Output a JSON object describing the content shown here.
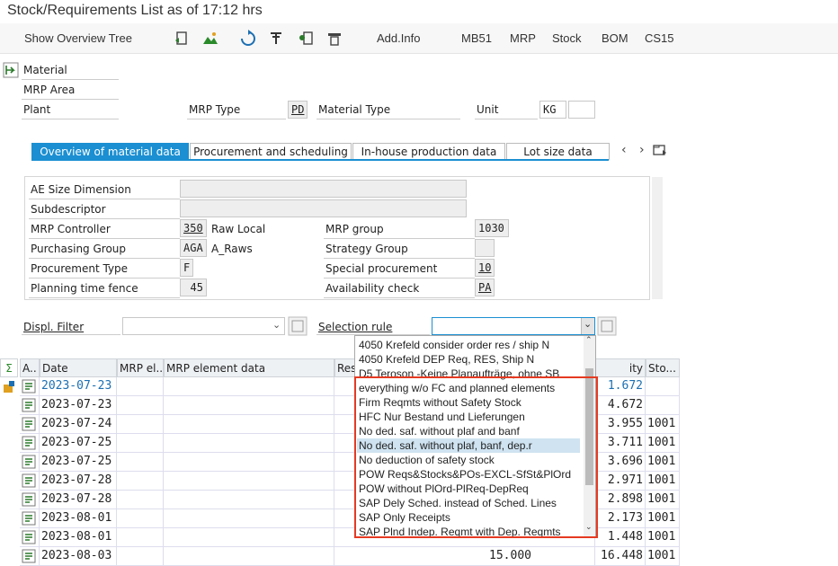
{
  "window": {
    "title": "Stock/Requirements List as of 17:12 hrs"
  },
  "toolbar": {
    "show_overview_tree": "Show Overview Tree",
    "add_info": "Add.Info",
    "mb51": "MB51",
    "mrp": "MRP",
    "stock": "Stock",
    "bom": "BOM",
    "cs15": "CS15"
  },
  "header": {
    "material_label": "Material",
    "mrp_area_label": "MRP Area",
    "plant_label": "Plant",
    "mrp_type_label": "MRP Type",
    "mrp_type_value": "PD",
    "material_type_label": "Material Type",
    "unit_label": "Unit",
    "unit_value": "KG"
  },
  "tabs": [
    {
      "label": "Overview of material data"
    },
    {
      "label": "Procurement and scheduling"
    },
    {
      "label": "In-house production data"
    },
    {
      "label": "Lot size data"
    }
  ],
  "overview": {
    "ae_size_label": "AE Size Dimension",
    "subdescriptor_label": "Subdescriptor",
    "mrp_controller_label": "MRP Controller",
    "mrp_controller_value": "350",
    "mrp_controller_text": "Raw Local",
    "mrp_group_label": "MRP group",
    "mrp_group_value": "1030",
    "purchasing_group_label": "Purchasing Group",
    "purchasing_group_value": "AGA",
    "purchasing_group_text": "A_Raws",
    "strategy_group_label": "Strategy Group",
    "procurement_type_label": "Procurement Type",
    "procurement_type_value": "F",
    "special_procurement_label": "Special procurement",
    "special_procurement_value": "10",
    "planning_time_fence_label": "Planning time fence",
    "planning_time_fence_value": "45",
    "availability_check_label": "Availability check",
    "availability_check_value": "PA"
  },
  "filters": {
    "displ_filter_label": "Displ. Filter",
    "selection_rule_label": "Selection rule"
  },
  "grid": {
    "headers": [
      "A..",
      "Date",
      "MRP el...",
      "MRP element data",
      "Res",
      "ity",
      "Sto..."
    ],
    "rows": [
      {
        "date": "2023-07-23",
        "qty": "1.672",
        "sto": "",
        "blue": true
      },
      {
        "date": "2023-07-23",
        "qty": "4.672",
        "sto": "",
        "blue": false
      },
      {
        "date": "2023-07-24",
        "qty": "3.955",
        "sto": "1001",
        "blue": false
      },
      {
        "date": "2023-07-25",
        "qty": "3.711",
        "sto": "1001",
        "blue": false
      },
      {
        "date": "2023-07-25",
        "qty": "3.696",
        "sto": "1001",
        "blue": false
      },
      {
        "date": "2023-07-28",
        "qty": "2.971",
        "sto": "1001",
        "blue": false
      },
      {
        "date": "2023-07-28",
        "qty": "2.898",
        "sto": "1001",
        "blue": false
      },
      {
        "date": "2023-08-01",
        "qty": "2.173",
        "sto": "1001",
        "blue": false
      },
      {
        "date": "2023-08-01",
        "qty": "1.448",
        "sto": "1001",
        "blue": false
      },
      {
        "date": "2023-08-03",
        "qty": "16.448",
        "sto": "1001",
        "blue": false,
        "rec": "15.000"
      }
    ]
  },
  "dropdown": {
    "items": [
      "4050 Krefeld consider order res / ship N",
      "4050 Krefeld DEP Req, RES, Ship N",
      "D5 Teroson -Keine Planaufträge, ohne SB",
      "everything w/o FC and planned elements",
      "Firm Reqmts without Safety Stock",
      "HFC Nur Bestand und Lieferungen",
      "No ded. saf. without plaf and banf",
      "No ded. saf. without plaf, banf, dep.r",
      "No deduction of safety stock",
      "POW Reqs&Stocks&POs-EXCL-SfSt&PlOrd",
      "POW without PlOrd-PlReq-DepReq",
      "SAP Dely Sched. instead of Sched. Lines",
      "SAP Only Receipts",
      "SAP Plnd Indep. Reqmt with Dep. Reqmts"
    ],
    "selected_index": 7
  },
  "colors": {
    "accent": "#1b8fd2",
    "highlight_box": "#e53a22",
    "selected_item": "#cfe3f1"
  }
}
